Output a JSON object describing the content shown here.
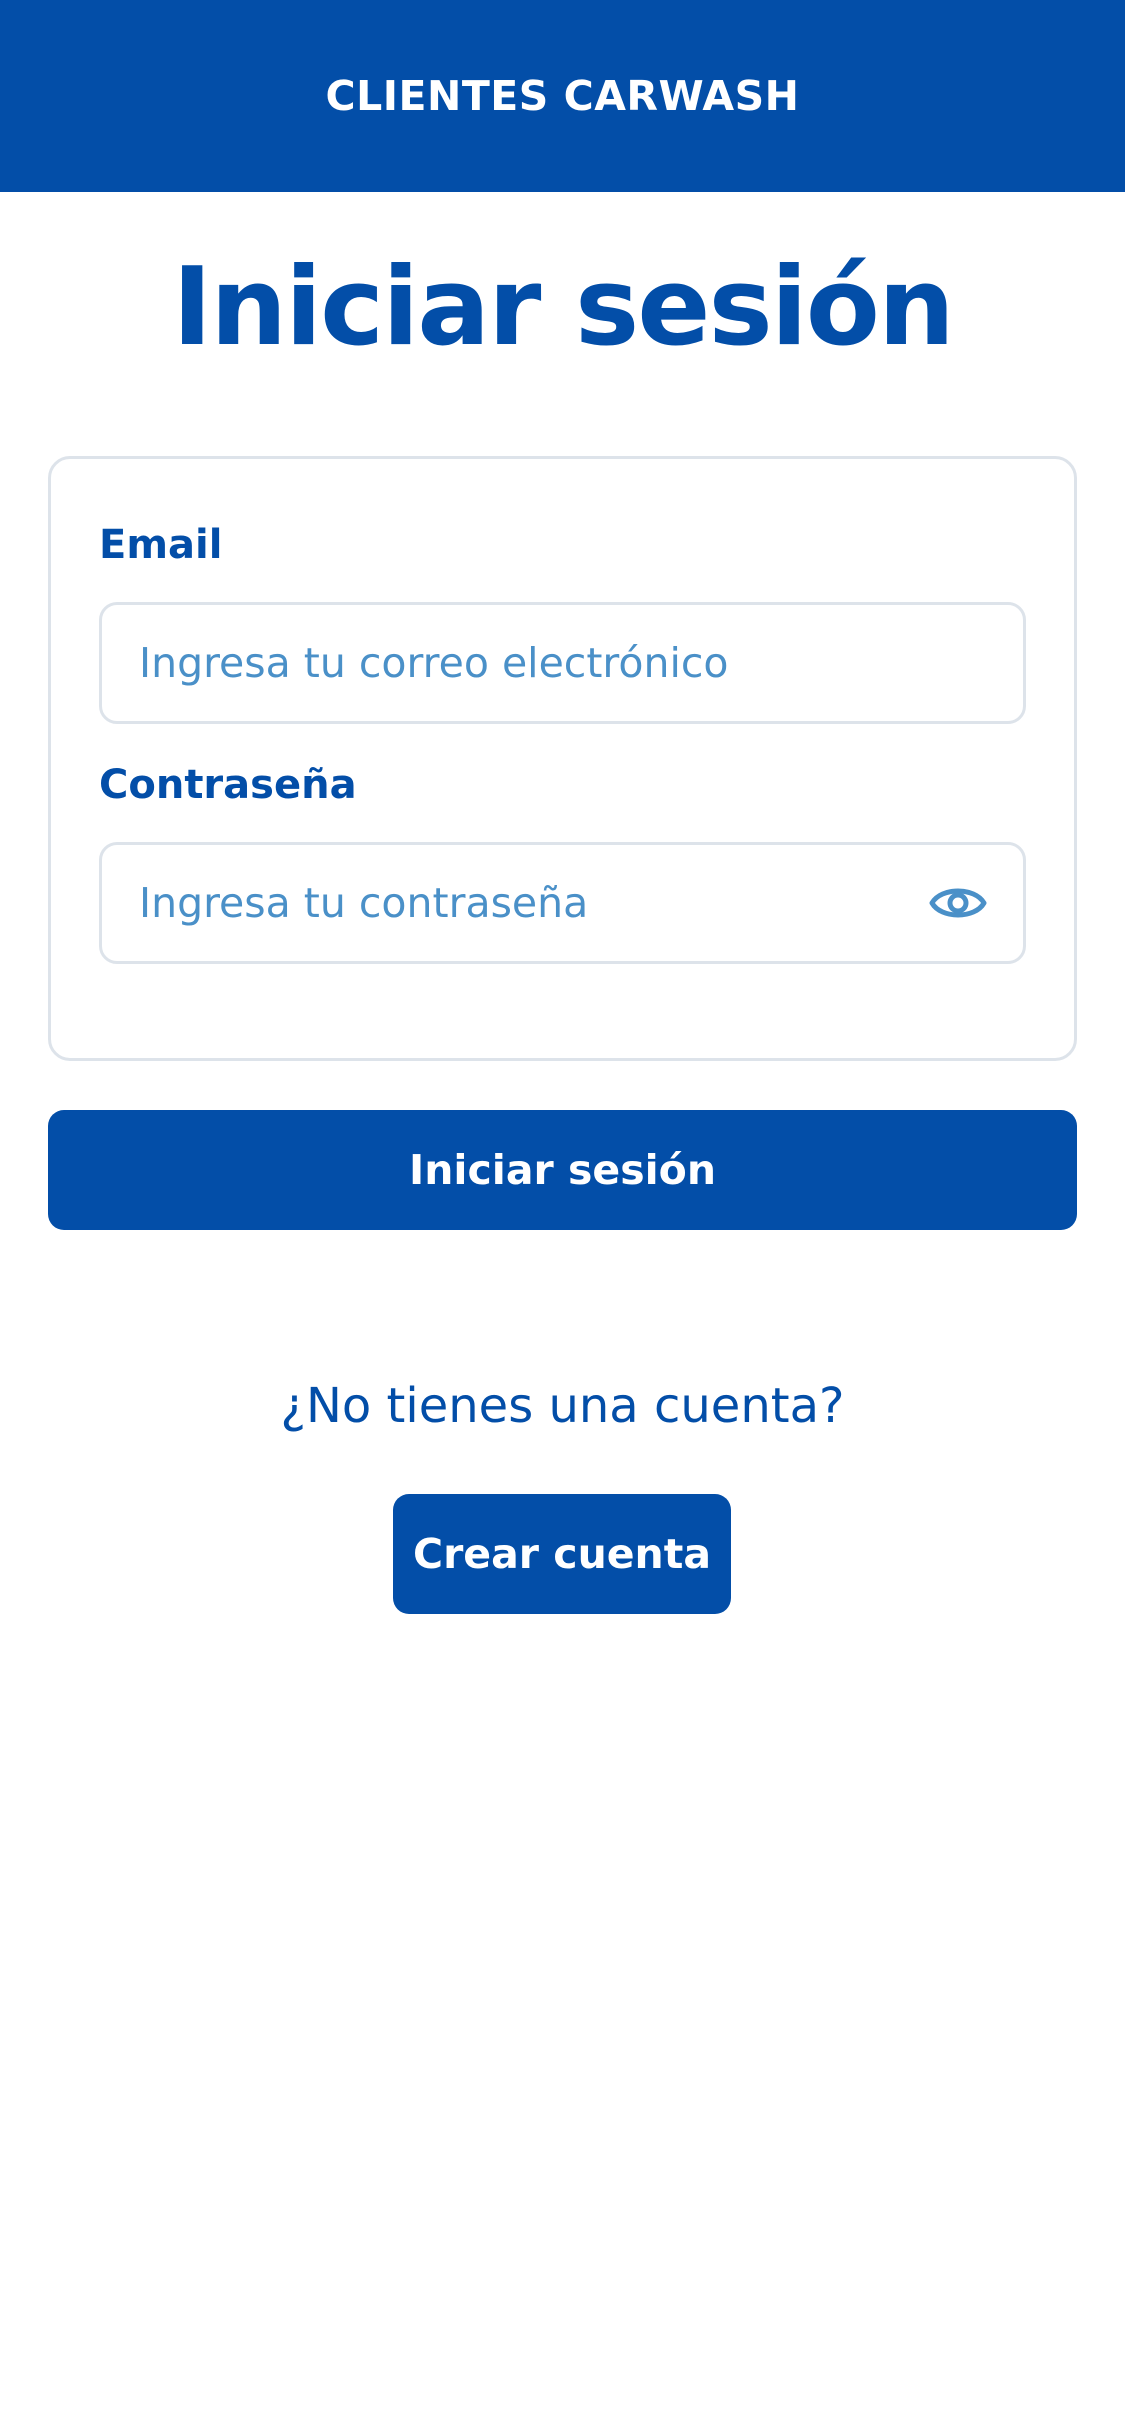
{
  "app_bar": {
    "title": "CLIENTES CARWASH"
  },
  "page": {
    "title": "Iniciar sesión"
  },
  "form": {
    "email_label": "Email",
    "email_placeholder": "Ingresa tu correo electrónico",
    "password_label": "Contraseña",
    "password_placeholder": "Ingresa tu contraseña",
    "password_toggle_icon": "eye-icon"
  },
  "actions": {
    "login_label": "Iniciar sesión",
    "no_account_text": "¿No tienes una cuenta?",
    "create_account_label": "Crear cuenta"
  },
  "colors": {
    "primary": "#034ea8",
    "placeholder": "#4a90c8",
    "border": "#dde3ea",
    "background": "#ffffff"
  }
}
